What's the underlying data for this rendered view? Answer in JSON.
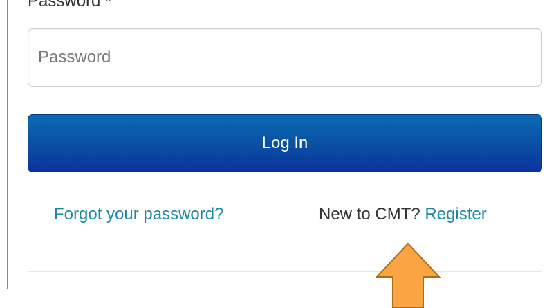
{
  "login_form": {
    "password_label": "Password *",
    "password_placeholder": "Password",
    "login_button_label": "Log In",
    "forgot_password_link": "Forgot your password?",
    "new_user_prompt": "New to CMT?",
    "register_link": "Register"
  },
  "annotation": {
    "icon": "arrow-up-icon",
    "color": "#fba444"
  },
  "colors": {
    "link": "#1f86a8",
    "button_top": "#0b6ab3",
    "button_bottom": "#0b33a0"
  }
}
